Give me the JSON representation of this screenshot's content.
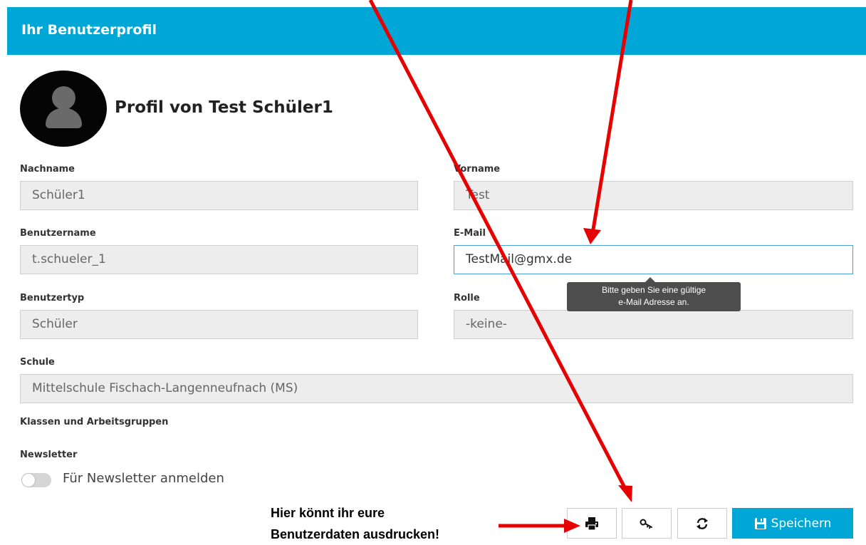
{
  "header": {
    "title": "Ihr Benutzerprofil"
  },
  "profile": {
    "title": "Profil von Test Schüler1"
  },
  "fields": {
    "nachname": {
      "label": "Nachname",
      "value": "Schüler1"
    },
    "vorname": {
      "label": "Vorname",
      "value": "Test"
    },
    "benutzername": {
      "label": "Benutzername",
      "value": "t.schueler_1"
    },
    "email": {
      "label": "E-Mail",
      "value": "TestMail@gmx.de"
    },
    "benutzertyp": {
      "label": "Benutzertyp",
      "value": "Schüler"
    },
    "rolle": {
      "label": "Rolle",
      "value": "-keine-"
    },
    "schule": {
      "label": "Schule",
      "value": "Mittelschule Fischach-Langenneufnach (MS)"
    }
  },
  "tooltip": {
    "line1": "Bitte geben Sie eine gültige",
    "line2": "e-Mail Adresse an."
  },
  "groups": {
    "label": "Klassen und Arbeitsgruppen"
  },
  "newsletter": {
    "label": "Newsletter",
    "toggle_label": "Für Newsletter anmelden",
    "enabled": false
  },
  "actions": {
    "print_icon": "printer-icon",
    "key_icon": "key-icon",
    "refresh_icon": "refresh-icon",
    "save_icon": "floppy-disk-icon",
    "save_label": "Speichern"
  },
  "annotation": {
    "line1": "Hier könnt ihr eure",
    "line2": "Benutzerdaten ausdrucken!"
  },
  "colors": {
    "accent": "#00a6d6",
    "arrow": "#e60000",
    "field_bg": "#ededed"
  }
}
